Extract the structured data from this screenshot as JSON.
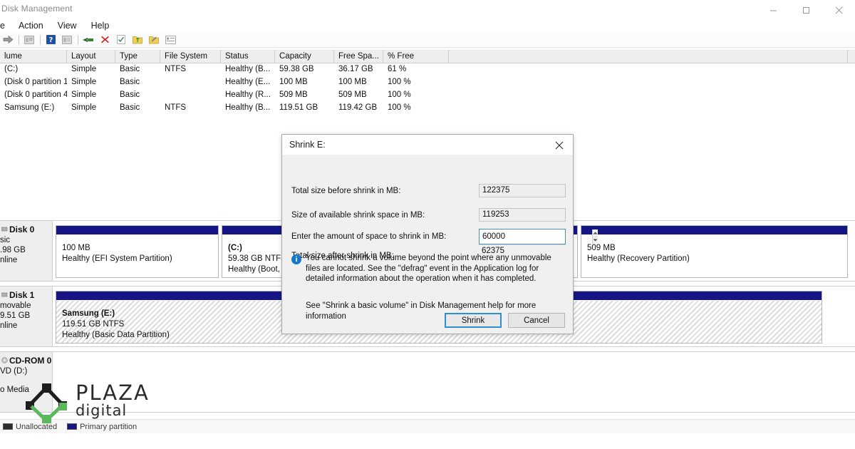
{
  "window": {
    "title": "Disk Management",
    "controls": [
      {
        "name": "minimize",
        "glyph": "minimize-icon"
      },
      {
        "name": "maximize",
        "glyph": "maximize-icon"
      },
      {
        "name": "close",
        "glyph": "close-icon"
      }
    ]
  },
  "menu": [
    {
      "label": "e",
      "clipped": true
    },
    {
      "label": "Action"
    },
    {
      "label": "View"
    },
    {
      "label": "Help"
    }
  ],
  "toolbar": {
    "items": [
      {
        "name": "forward-arrow-icon",
        "kind": "arrow-right"
      },
      {
        "name": "separator",
        "kind": "sep"
      },
      {
        "name": "show-hide-console-tree-icon",
        "kind": "grid-gray"
      },
      {
        "name": "separator",
        "kind": "sep"
      },
      {
        "name": "help-icon",
        "kind": "help-blue"
      },
      {
        "name": "properties-icon",
        "kind": "grid-gray2"
      },
      {
        "name": "separator",
        "kind": "sep"
      },
      {
        "name": "connect-icon",
        "kind": "plug"
      },
      {
        "name": "delete-icon",
        "kind": "red-x"
      },
      {
        "name": "checklist-icon",
        "kind": "check-doc"
      },
      {
        "name": "import-icon",
        "kind": "folder-up"
      },
      {
        "name": "export-icon",
        "kind": "folder-pencil"
      },
      {
        "name": "list-view-icon",
        "kind": "list-box"
      }
    ]
  },
  "volume_list": {
    "columns": [
      "lume",
      "Layout",
      "Type",
      "File System",
      "Status",
      "Capacity",
      "Free Spa...",
      "% Free",
      ""
    ],
    "rows": [
      {
        "volume": "(C:)",
        "layout": "Simple",
        "type": "Basic",
        "filesystem": "NTFS",
        "status": "Healthy (B...",
        "capacity": "59.38 GB",
        "free_space": "36.17 GB",
        "percent_free": "61 %"
      },
      {
        "volume": "(Disk 0 partition 1)",
        "layout": "Simple",
        "type": "Basic",
        "filesystem": "",
        "status": "Healthy (E...",
        "capacity": "100 MB",
        "free_space": "100 MB",
        "percent_free": "100 %"
      },
      {
        "volume": "(Disk 0 partition 4)",
        "layout": "Simple",
        "type": "Basic",
        "filesystem": "",
        "status": "Healthy (R...",
        "capacity": "509 MB",
        "free_space": "509 MB",
        "percent_free": "100 %"
      },
      {
        "volume": "Samsung (E:)",
        "layout": "Simple",
        "type": "Basic",
        "filesystem": "NTFS",
        "status": "Healthy (B...",
        "capacity": "119.51 GB",
        "free_space": "119.42 GB",
        "percent_free": "100 %"
      }
    ]
  },
  "disks": [
    {
      "name": "Disk 0",
      "type": "sic",
      "size": ".98 GB",
      "state": "nline",
      "partitions": [
        {
          "title": "",
          "size": "100 MB",
          "status": "Healthy (EFI System Partition)",
          "selected": false
        },
        {
          "title": "(C:)",
          "size": "59.38 GB NTFS",
          "status": "Healthy (Boot, Pa",
          "selected": false
        },
        {
          "title": "",
          "size": "509 MB",
          "status": "Healthy (Recovery Partition)",
          "selected": false
        }
      ]
    },
    {
      "name": "Disk 1",
      "type": "movable",
      "size": "9.51 GB",
      "state": "nline",
      "partitions": [
        {
          "title": "Samsung  (E:)",
          "size": "119.51 GB NTFS",
          "status": "Healthy (Basic Data Partition)",
          "selected": true
        }
      ]
    },
    {
      "name": "CD-ROM 0",
      "type": "VD (D:)",
      "size": "",
      "state": "o Media",
      "partitions": []
    }
  ],
  "legend": [
    {
      "label": "Unallocated",
      "color": "#2c2c2c"
    },
    {
      "label": "Primary partition",
      "color": "#151585"
    }
  ],
  "dialog": {
    "title": "Shrink E:",
    "close_icon": "close-icon",
    "fields": [
      {
        "label": "Total size before shrink in MB:",
        "value": "122375",
        "editable": false,
        "style": "boxed"
      },
      {
        "label": "Size of available shrink space in MB:",
        "value": "119253",
        "editable": false,
        "style": "boxed"
      },
      {
        "label": "Enter the amount of space to shrink in MB:",
        "value": "60000",
        "editable": true,
        "style": "spinner"
      },
      {
        "label": "Total size after shrink in MB:",
        "value": "62375",
        "editable": false,
        "style": "plain"
      }
    ],
    "info_icon": "info-icon",
    "info_text": "You cannot shrink a volume beyond the point where any unmovable files are located. See the \"defrag\" event in the Application log for detailed information about the operation when it has completed.",
    "help_text": "See \"Shrink a basic volume\" in Disk Management help for more information",
    "buttons": {
      "primary": "Shrink",
      "secondary": "Cancel"
    },
    "accent_color": "#2f8fd0"
  },
  "watermark": {
    "line1": "PLAZA",
    "line2": "digital",
    "dark_color": "#2b2b2b",
    "green_color": "#5cb85c"
  }
}
